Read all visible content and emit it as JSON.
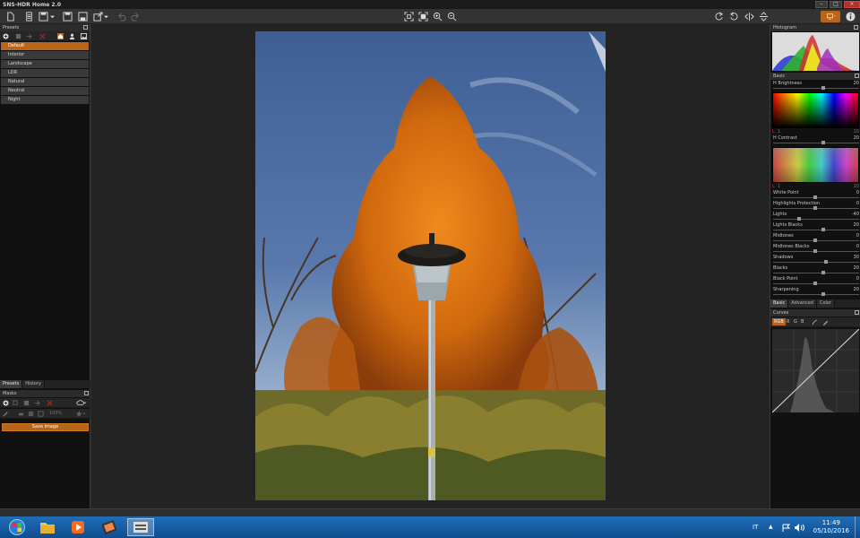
{
  "window": {
    "title": "SNS-HDR Home 2.0"
  },
  "presets_panel": {
    "title": "Presets",
    "items": [
      "Default",
      "Interior",
      "Landscape",
      "LDR",
      "Natural",
      "Neutral",
      "Night"
    ],
    "selected": "Default"
  },
  "left_tabs": [
    "Presets",
    "History"
  ],
  "masks_panel": {
    "title": "Masks",
    "zoom_value": "100%",
    "save_label": "Save image"
  },
  "histogram_panel": {
    "title": "Histogram"
  },
  "basic_panel": {
    "title": "Basic",
    "brightness": {
      "label": "Brightness",
      "value": "20",
      "h": "H",
      "l": "L",
      "range_left": "1",
      "range_right": "10"
    },
    "contrast": {
      "label": "Contrast",
      "value": "20",
      "h": "H",
      "l": "L",
      "range_left": "1",
      "range_right": "10"
    },
    "sliders": [
      {
        "label": "White Point",
        "value": "0",
        "pos": 0.5
      },
      {
        "label": "Highlights Protection",
        "value": "0",
        "pos": 0.5
      },
      {
        "label": "Lights",
        "value": "-40",
        "pos": 0.3
      },
      {
        "label": "Lights Blacks",
        "value": "20",
        "pos": 0.6
      },
      {
        "label": "Midtones",
        "value": "0",
        "pos": 0.5
      },
      {
        "label": "Midtones Blacks",
        "value": "0",
        "pos": 0.5
      },
      {
        "label": "Shadows",
        "value": "30",
        "pos": 0.63
      },
      {
        "label": "Blacks",
        "value": "20",
        "pos": 0.6
      },
      {
        "label": "Black Point",
        "value": "0",
        "pos": 0.5
      },
      {
        "label": "Sharpening",
        "value": "20",
        "pos": 0.6
      }
    ]
  },
  "right_tabs": [
    "Basic",
    "Advanced",
    "Color"
  ],
  "curves_panel": {
    "title": "Curves",
    "channels": [
      "RGB",
      "R",
      "G",
      "B"
    ],
    "selected": "RGB"
  },
  "taskbar": {
    "language": "IT",
    "time": "11:49",
    "date": "05/10/2016"
  },
  "colors": {
    "accent": "#b8651c",
    "panel": "#111111",
    "taskbar": "#1e6fb8"
  }
}
